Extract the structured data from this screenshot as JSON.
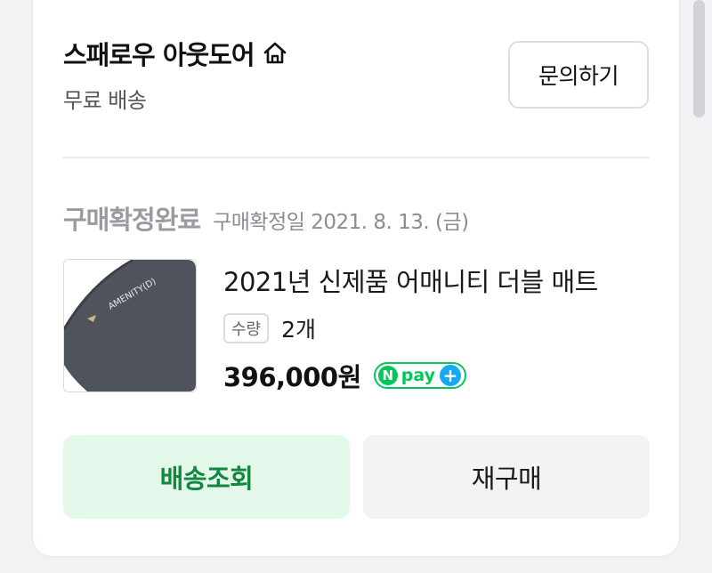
{
  "store": {
    "name": "스패로우 아웃도어",
    "shipping": "무료 배송",
    "inquiry_label": "문의하기"
  },
  "order": {
    "status": "구매확정완료",
    "confirm_date": "구매확정일 2021. 8. 13. (금)"
  },
  "product": {
    "name": "2021년 신제품 어매니티 더블 매트",
    "qty_label": "수량",
    "qty_value": "2개",
    "price": "396,000원",
    "thumbnail_text": "AMENITY(D)"
  },
  "npay": {
    "n": "N",
    "text": "pay",
    "plus": "+"
  },
  "actions": {
    "track_label": "배송조회",
    "rebuy_label": "재구매"
  },
  "icons": {
    "home": "home-icon"
  },
  "colors": {
    "npay_green": "#03c75a",
    "npay_blue": "#16a8f5",
    "track_button_bg": "#e3f8ea",
    "track_button_text": "#11883e"
  }
}
